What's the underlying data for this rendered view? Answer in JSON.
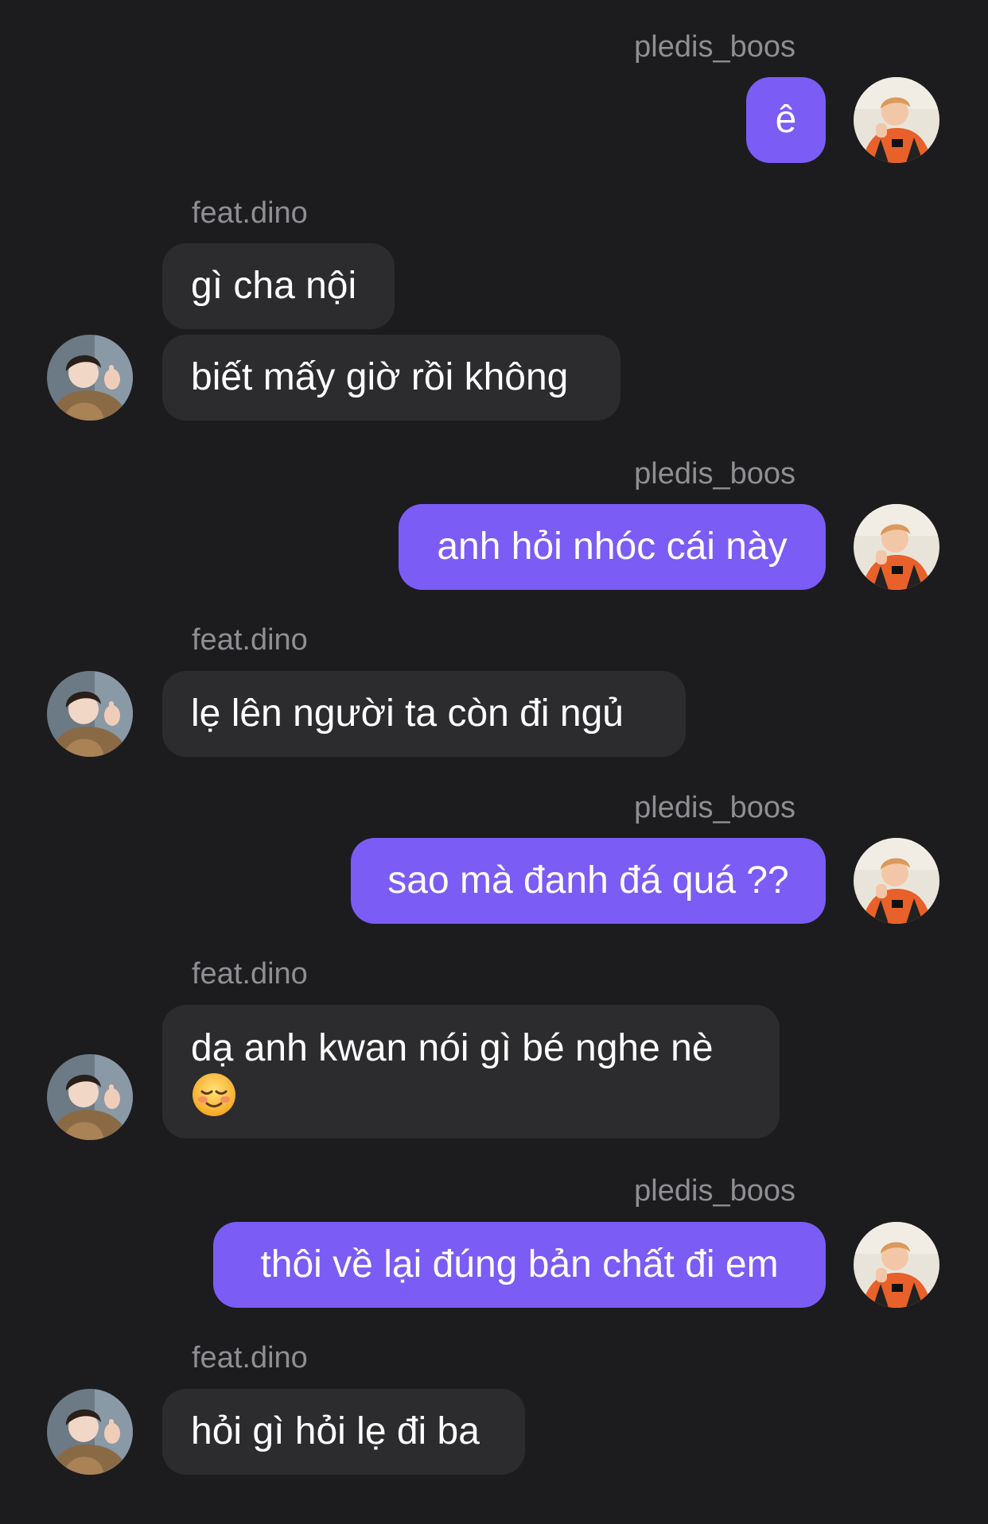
{
  "chat": {
    "messages": [
      {
        "sender": "pledis_boos",
        "direction": "outgoing",
        "text": "ê"
      },
      {
        "sender": "feat.dino",
        "direction": "incoming",
        "text": "gì cha nội"
      },
      {
        "sender": "feat.dino",
        "direction": "incoming",
        "text": "biết mấy giờ rồi không"
      },
      {
        "sender": "pledis_boos",
        "direction": "outgoing",
        "text": "anh hỏi nhóc cái này"
      },
      {
        "sender": "feat.dino",
        "direction": "incoming",
        "text": "lẹ lên người ta còn đi ngủ"
      },
      {
        "sender": "pledis_boos",
        "direction": "outgoing",
        "text": "sao mà đanh đá quá ??"
      },
      {
        "sender": "feat.dino",
        "direction": "incoming",
        "text": "dạ anh kwan nói gì bé nghe nè",
        "emoji": "smiling-face-emoji"
      },
      {
        "sender": "pledis_boos",
        "direction": "outgoing",
        "text": "thôi về lại đúng bản chất đi em"
      },
      {
        "sender": "feat.dino",
        "direction": "incoming",
        "text": "hỏi gì hỏi lẹ đi ba"
      }
    ]
  },
  "colors": {
    "background": "#1c1c1e",
    "outgoing_bubble": "#7b5cf5",
    "incoming_bubble": "#2c2c2e",
    "sender_name": "#8e8e93",
    "text": "#ffffff"
  },
  "icons": {
    "outgoing_avatar": "avatar-pledis_boos",
    "incoming_avatar": "avatar-feat.dino",
    "emoji": "smiling-face-emoji"
  }
}
